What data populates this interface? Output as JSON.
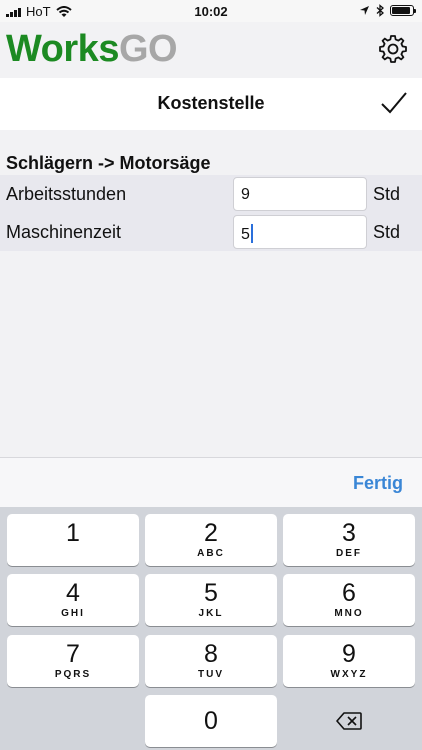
{
  "status_bar": {
    "carrier": "HoT",
    "time": "10:02"
  },
  "app_header": {
    "logo_part1": "Works",
    "logo_part2": "GO"
  },
  "nav": {
    "title": "Kostenstelle"
  },
  "form": {
    "section_title": "Schlägern -> Motorsäge",
    "rows": [
      {
        "label": "Arbeitsstunden",
        "value": "9",
        "unit": "Std"
      },
      {
        "label": "Maschinenzeit",
        "value": "5",
        "unit": "Std"
      }
    ]
  },
  "toolbar": {
    "done_label": "Fertig"
  },
  "keyboard": {
    "keys": [
      {
        "num": "1",
        "letters": ""
      },
      {
        "num": "2",
        "letters": "ABC"
      },
      {
        "num": "3",
        "letters": "DEF"
      },
      {
        "num": "4",
        "letters": "GHI"
      },
      {
        "num": "5",
        "letters": "JKL"
      },
      {
        "num": "6",
        "letters": "MNO"
      },
      {
        "num": "7",
        "letters": "PQRS"
      },
      {
        "num": "8",
        "letters": "TUV"
      },
      {
        "num": "9",
        "letters": "WXYZ"
      },
      {
        "num": "0",
        "letters": ""
      }
    ]
  },
  "colors": {
    "logo_green": "#1c8a22",
    "logo_gray": "#a7a7a7",
    "accent_blue": "#3a86d6"
  }
}
